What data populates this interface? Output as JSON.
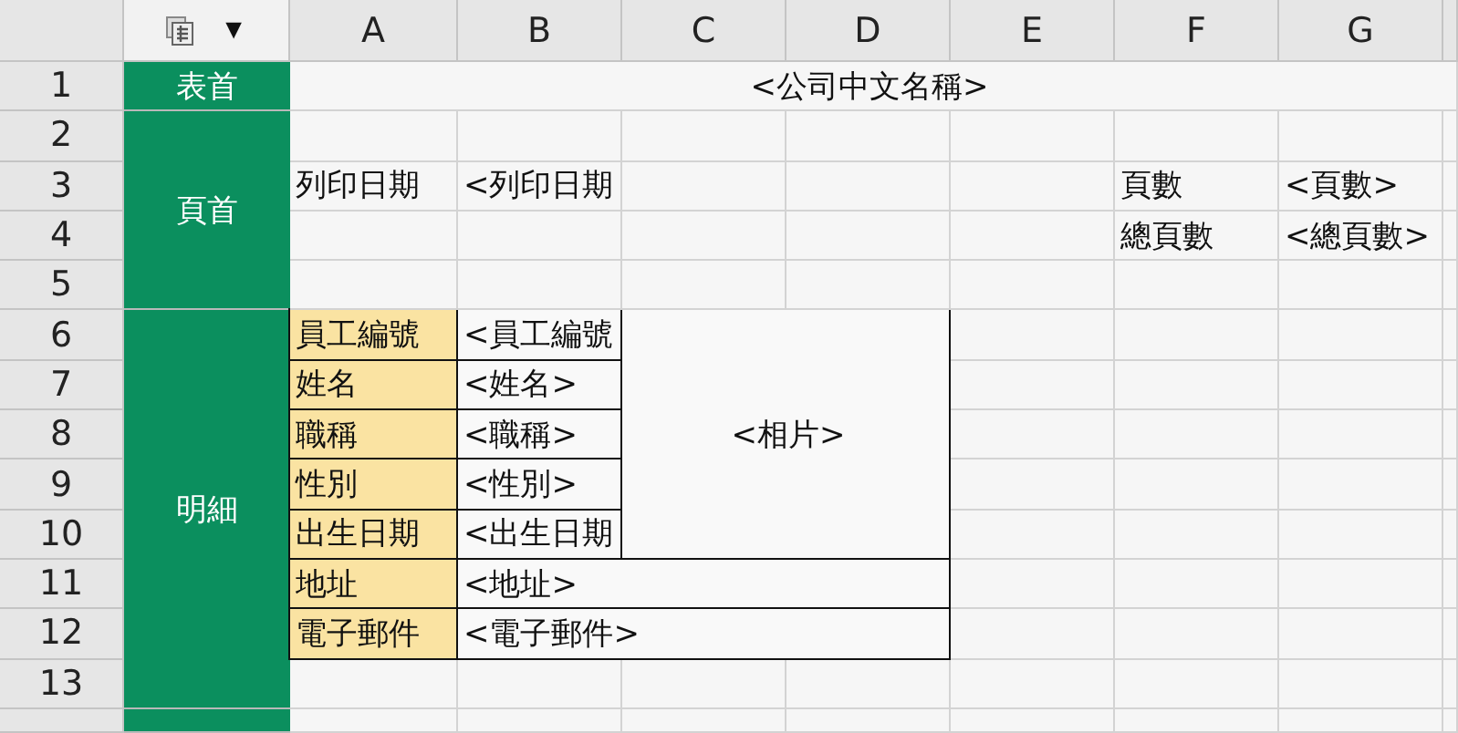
{
  "corner": {
    "menu_glyph": "▼"
  },
  "columns": [
    "A",
    "B",
    "C",
    "D",
    "E",
    "F",
    "G"
  ],
  "sections": [
    {
      "label": "表首",
      "rows": [
        {
          "header": "1",
          "cells": [
            {
              "kind": "title",
              "text": "<公司中文名稱>"
            },
            null,
            null,
            null,
            null,
            null,
            null
          ]
        }
      ]
    },
    {
      "label": "頁首",
      "rows": [
        {
          "header": "2",
          "cells": [
            null,
            null,
            null,
            null,
            null,
            null,
            null
          ]
        },
        {
          "header": "3",
          "cells": [
            {
              "kind": "plain",
              "text": "列印日期"
            },
            {
              "kind": "plain",
              "text": "<列印日期"
            },
            null,
            null,
            null,
            {
              "kind": "plain",
              "text": "頁數"
            },
            {
              "kind": "plain",
              "text": "<頁數>"
            }
          ]
        },
        {
          "header": "4",
          "cells": [
            null,
            null,
            null,
            null,
            null,
            {
              "kind": "plain",
              "text": "總頁數"
            },
            {
              "kind": "plain",
              "text": "<總頁數>"
            }
          ]
        },
        {
          "header": "5",
          "cells": [
            null,
            null,
            null,
            null,
            null,
            null,
            null
          ]
        }
      ]
    },
    {
      "label": "明細",
      "rows": [
        {
          "header": "6",
          "cells": [
            {
              "kind": "label",
              "text": "員工編號"
            },
            {
              "kind": "value",
              "text": "<員工編號"
            },
            null,
            null,
            null,
            null,
            null
          ]
        },
        {
          "header": "7",
          "cells": [
            {
              "kind": "label",
              "text": "姓名"
            },
            {
              "kind": "value",
              "text": "<姓名>"
            },
            null,
            null,
            null,
            null,
            null
          ]
        },
        {
          "header": "8",
          "cells": [
            {
              "kind": "label",
              "text": "職稱"
            },
            {
              "kind": "value",
              "text": "<職稱>"
            },
            {
              "kind": "photo",
              "text": "<相片>"
            },
            null,
            null,
            null,
            null
          ]
        },
        {
          "header": "9",
          "cells": [
            {
              "kind": "label",
              "text": "性別"
            },
            {
              "kind": "value",
              "text": "<性別>"
            },
            null,
            null,
            null,
            null,
            null
          ]
        },
        {
          "header": "10",
          "cells": [
            {
              "kind": "label",
              "text": "出生日期"
            },
            {
              "kind": "value",
              "text": "<出生日期"
            },
            null,
            null,
            null,
            null,
            null
          ]
        },
        {
          "header": "11",
          "cells": [
            {
              "kind": "label",
              "text": "地址"
            },
            {
              "kind": "wide",
              "text": "<地址>"
            },
            null,
            null,
            null,
            null,
            null
          ]
        },
        {
          "header": "12",
          "cells": [
            {
              "kind": "label",
              "text": "電子郵件"
            },
            {
              "kind": "wide",
              "text": "<電子郵件>"
            },
            null,
            null,
            null,
            null,
            null
          ]
        },
        {
          "header": "13",
          "cells": [
            null,
            null,
            null,
            null,
            null,
            null,
            null
          ]
        }
      ]
    }
  ]
}
